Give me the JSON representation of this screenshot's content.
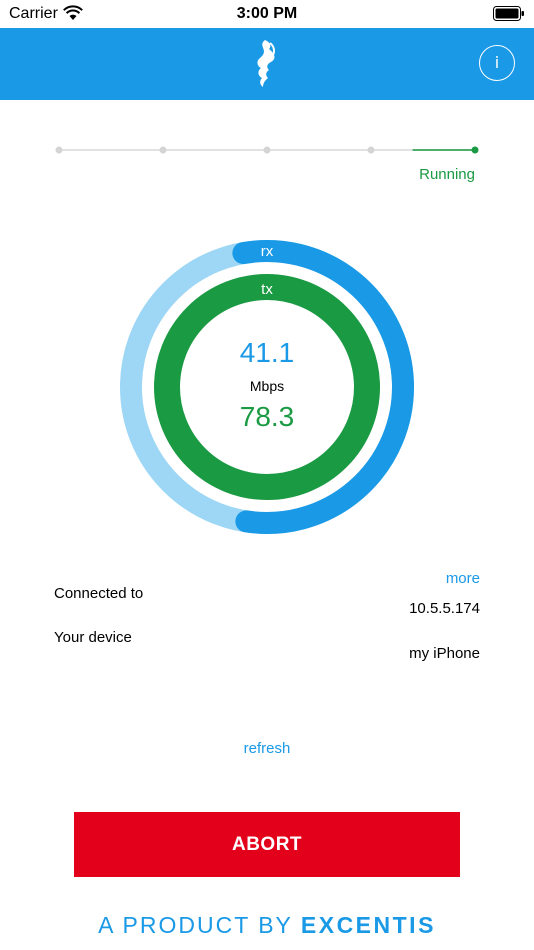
{
  "status_bar": {
    "carrier": "Carrier",
    "time": "3:00 PM"
  },
  "nav": {
    "info_label": "i"
  },
  "progress": {
    "steps": 5,
    "current_step": 5,
    "status": "Running"
  },
  "gauge": {
    "rx_label": "rx",
    "tx_label": "tx",
    "rx_value": "41.1",
    "tx_value": "78.3",
    "unit": "Mbps",
    "rx_fill": 0.6,
    "tx_fill": 1.0
  },
  "details": {
    "more_label": "more",
    "connected_label": "Connected to",
    "connected_value": "10.5.5.174",
    "device_label": "Your device",
    "device_value": "my iPhone"
  },
  "actions": {
    "refresh_label": "refresh",
    "abort_label": "ABORT"
  },
  "footer": {
    "tagline": "A PRODUCT BY",
    "brand": "EXCENTIS"
  },
  "colors": {
    "brand_blue": "#1999e6",
    "light_blue": "#9dd7f5",
    "green": "#1a9a42",
    "red": "#e3001b"
  }
}
